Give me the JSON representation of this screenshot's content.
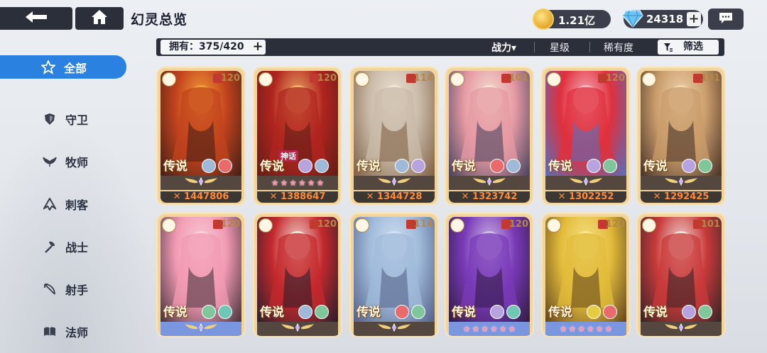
{
  "header": {
    "title": "幻灵总览",
    "gold": "1.21亿",
    "gems": "24318",
    "gold_plus": "",
    "gems_plus": "+"
  },
  "filterbar": {
    "owned": "拥有：375/420",
    "own_plus": "+",
    "sort_power": "战力▾",
    "sort_star": "星级",
    "sort_rarity": "稀有度",
    "filter": "筛选"
  },
  "sidebar": {
    "items": [
      {
        "label": "全部",
        "icon": "star-outline-icon"
      },
      {
        "label": "守卫",
        "icon": "shield-icon"
      },
      {
        "label": "牧师",
        "icon": "priest-wing-icon"
      },
      {
        "label": "刺客",
        "icon": "assassin-icon"
      },
      {
        "label": "战士",
        "icon": "axe-icon"
      },
      {
        "label": "射手",
        "icon": "bow-icon"
      },
      {
        "label": "法师",
        "icon": "book-icon"
      }
    ]
  },
  "cards": [
    {
      "level": "120",
      "rarity": "传说",
      "power": "1447806",
      "star_style": "wing",
      "art": [
        "#f6a23a",
        "#c2431d",
        "#3a1d16"
      ],
      "badges": [
        "#9fb9d9",
        "#e86a6a"
      ]
    },
    {
      "level": "120",
      "rarity": "传说",
      "power": "1388647",
      "star_style": "pinkstars",
      "tag": "神话",
      "art": [
        "#f2b46a",
        "#b0241f",
        "#5a1d16"
      ],
      "badges": [
        "#b7a3e0",
        "#9fb9d9"
      ]
    },
    {
      "level": "114",
      "rarity": "传说",
      "power": "1344728",
      "star_style": "wing",
      "art": [
        "#f1e6d8",
        "#c9b9a8",
        "#7a5a3d"
      ],
      "badges": [
        "#9fb9d9",
        "#b7a3e0"
      ]
    },
    {
      "level": "101",
      "rarity": "传说",
      "power": "1323742",
      "star_style": "wing",
      "art": [
        "#f7e4d4",
        "#e59aa3",
        "#3c3c5a"
      ],
      "badges": [
        "#e86a6a",
        "#9fb9d9"
      ]
    },
    {
      "level": "120",
      "rarity": "传说",
      "power": "1302252",
      "star_style": "wing",
      "art": [
        "#f6b9c3",
        "#e0303d",
        "#4b75c7"
      ],
      "badges": [
        "#b7a3e0",
        "#7fc79a"
      ]
    },
    {
      "level": "101",
      "rarity": "传说",
      "power": "1292425",
      "star_style": "wing",
      "art": [
        "#f4d8b5",
        "#c99c6a",
        "#3d2a24"
      ],
      "badges": [
        "#b7a3e0",
        "#7fc79a"
      ]
    },
    {
      "level": "120",
      "rarity": "传说",
      "power": "",
      "star_style": "wing-blue",
      "art": [
        "#f8d0da",
        "#f19ab3",
        "#3a2c33"
      ],
      "badges": [
        "#7fc79a",
        "#6fc7b5"
      ]
    },
    {
      "level": "120",
      "rarity": "传说",
      "power": "",
      "star_style": "wing",
      "art": [
        "#f6e9e0",
        "#c4282c",
        "#1e1e2c"
      ],
      "badges": [
        "#9fb9d9",
        "#7fc79a"
      ]
    },
    {
      "level": "114",
      "rarity": "传说",
      "power": "",
      "star_style": "wing",
      "art": [
        "#d4e3f4",
        "#9fb9d9",
        "#4e5b84"
      ],
      "badges": [
        "#e86a6a",
        "#7fc79a"
      ]
    },
    {
      "level": "120",
      "rarity": "传说",
      "power": "",
      "star_style": "bluestars",
      "art": [
        "#d4c1e9",
        "#7a3ab8",
        "#2a1a3a"
      ],
      "badges": [
        "#b7a3e0",
        "#6fc7b5"
      ]
    },
    {
      "level": "120",
      "rarity": "传说",
      "power": "",
      "star_style": "bluestars",
      "art": [
        "#f8e58c",
        "#e2bb3a",
        "#5a3e1c"
      ],
      "badges": [
        "#e6cc45",
        "#e86a6a"
      ]
    },
    {
      "level": "101",
      "rarity": "传说",
      "power": "",
      "star_style": "wing",
      "art": [
        "#f2e6e0",
        "#c93a3a",
        "#2a2226"
      ],
      "badges": [
        "#b7a3e0",
        "#7fc79a"
      ]
    }
  ],
  "colors": {
    "accent": "#2b81e0",
    "bar_dark": "#2a2f3a",
    "card_gold": "#f3d49a",
    "power_orange": "#ff8a3a"
  }
}
